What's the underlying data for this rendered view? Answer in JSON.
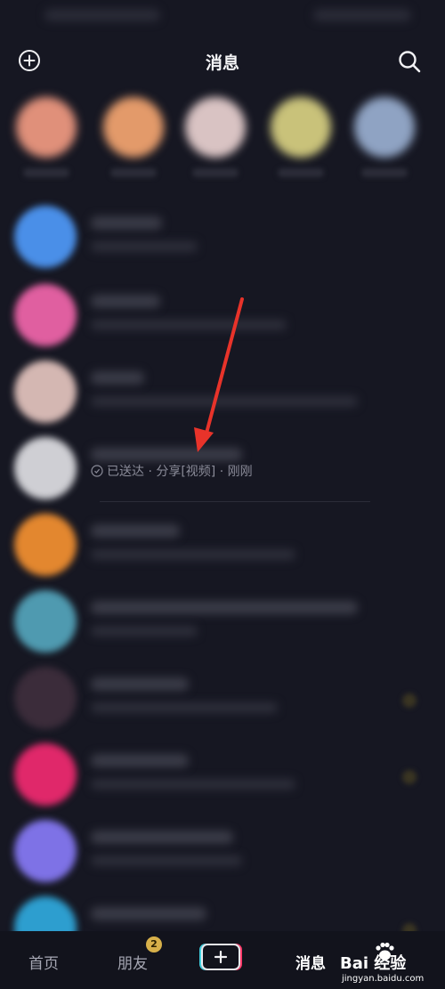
{
  "header": {
    "title": "消息",
    "left_icon": "plus-circle-icon",
    "right_icon": "search-icon"
  },
  "stories": [
    {
      "color": "#e0907a"
    },
    {
      "color": "#e39a6a"
    },
    {
      "color": "#d9c3c3"
    },
    {
      "color": "#c9c27a"
    },
    {
      "color": "#8fa3c3"
    }
  ],
  "conversations": [
    {
      "avatar_color": "#4a8fe8"
    },
    {
      "avatar_color": "#e05fa0"
    },
    {
      "avatar_color": "#d4b7b2"
    },
    {
      "avatar_color": "#cfcfd4",
      "preview": "已送达 · 分享[视频] · 刚刚"
    },
    {
      "avatar_color": "#e3872f"
    },
    {
      "avatar_color": "#4f9ab0"
    },
    {
      "avatar_color": "#3b2c3a"
    },
    {
      "avatar_color": "#e0286a"
    },
    {
      "avatar_color": "#7e72e6"
    },
    {
      "avatar_color": "#2d9ecf"
    }
  ],
  "tabbar": {
    "home": "首页",
    "friends": "朋友",
    "friends_badge": "2",
    "messages": "消息"
  },
  "watermark": {
    "text": "Bai  经验",
    "url": "jingyan.baidu.com"
  },
  "colors": {
    "background": "#161722",
    "annotation_arrow": "#e8332a"
  }
}
